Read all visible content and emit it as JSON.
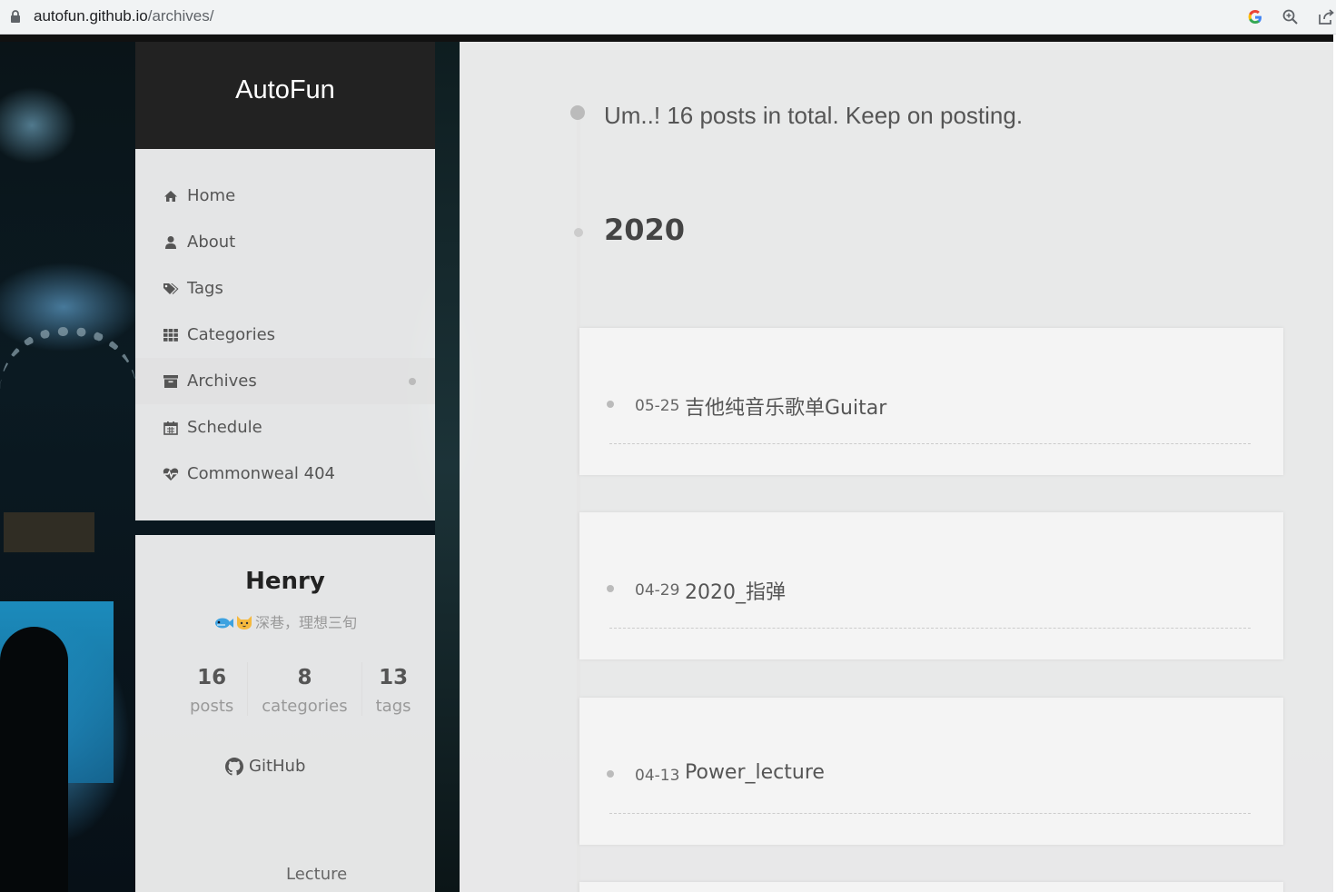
{
  "browser": {
    "url_host": "autofun.github.io",
    "url_path": "/archives/",
    "icons": [
      "lock-icon",
      "google-icon",
      "zoom-icon",
      "share-icon"
    ]
  },
  "site": {
    "title": "AutoFun"
  },
  "menu": {
    "items": [
      {
        "label": "Home",
        "icon": "home-icon"
      },
      {
        "label": "About",
        "icon": "user-icon"
      },
      {
        "label": "Tags",
        "icon": "tags-icon"
      },
      {
        "label": "Categories",
        "icon": "grid-icon"
      },
      {
        "label": "Archives",
        "icon": "archive-icon",
        "active": true
      },
      {
        "label": "Schedule",
        "icon": "calendar-icon"
      },
      {
        "label": "Commonweal 404",
        "icon": "heartbeat-icon"
      }
    ]
  },
  "profile": {
    "name": "Henry",
    "motto": "深巷，理想三旬",
    "stats": [
      {
        "count": "16",
        "label": "posts"
      },
      {
        "count": "8",
        "label": "categories"
      },
      {
        "count": "13",
        "label": "tags"
      }
    ],
    "github_label": "GitHub",
    "lecture_label": "Lecture"
  },
  "archive": {
    "intro": "Um..! 16 posts in total. Keep on posting.",
    "year": "2020",
    "posts": [
      {
        "date": "05-25",
        "title": "吉他纯音乐歌单Guitar"
      },
      {
        "date": "04-29",
        "title": "2020_指弹"
      },
      {
        "date": "04-13",
        "title": "Power_lecture"
      }
    ]
  },
  "colors": {
    "brand_bg": "#222222",
    "panel_bg": "#f5f5f5",
    "text": "#555555"
  }
}
